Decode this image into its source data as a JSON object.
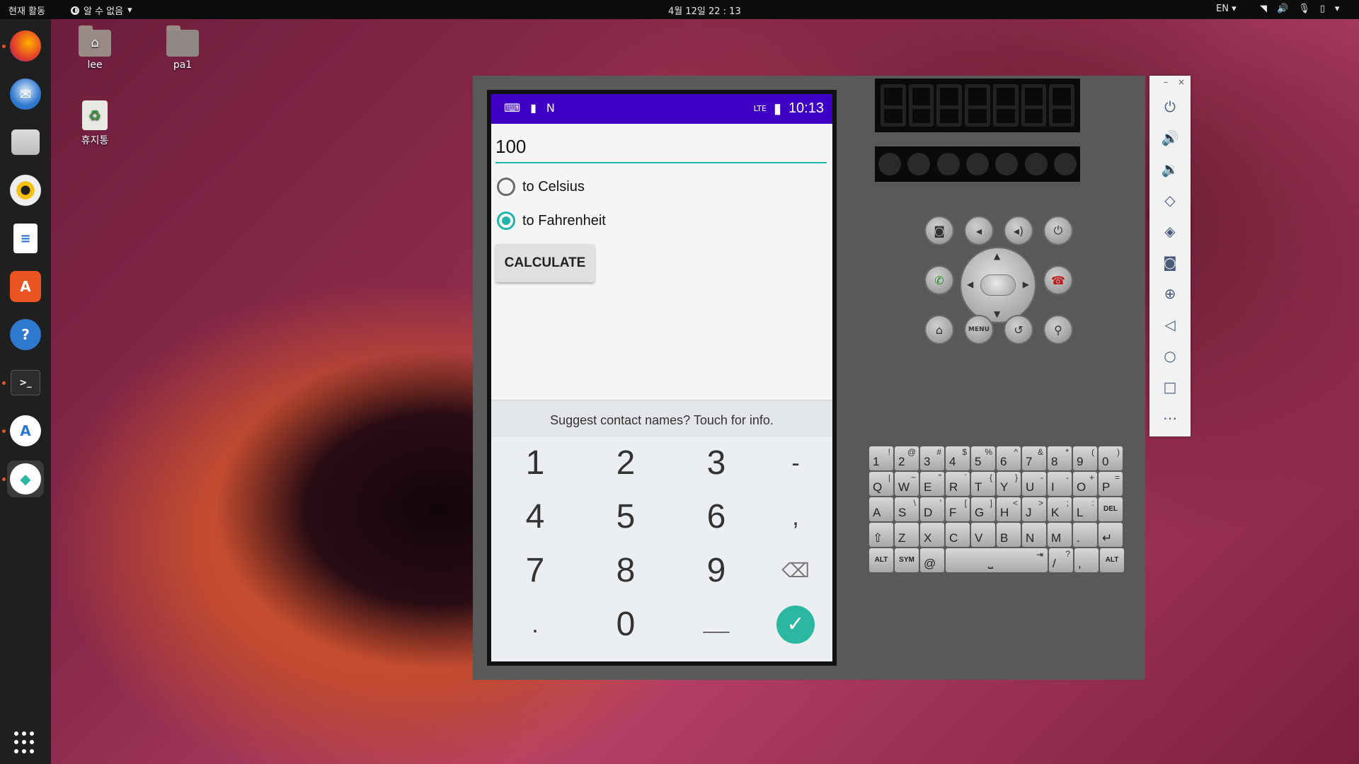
{
  "topbar": {
    "activities": "현재 활동",
    "notifications": "알 수 없음",
    "clock": "4월 12일  22 : 13",
    "lang": "EN",
    "tray_icons": [
      "wifi-icon",
      "volume-icon",
      "mic-icon",
      "battery-icon",
      "power-menu-icon"
    ]
  },
  "dock": {
    "items": [
      "firefox",
      "thunderbird",
      "files",
      "rhythmbox",
      "libreoffice-writer",
      "ubuntu-software",
      "help",
      "terminal",
      "android-studio",
      "android-emulator"
    ]
  },
  "desktop": {
    "icons": [
      {
        "label": "lee"
      },
      {
        "label": "pa1"
      },
      {
        "label": "휴지통"
      }
    ]
  },
  "phone": {
    "status_time": "10:13",
    "status_network": "LTE",
    "input_value": "100",
    "radio_celsius": "to Celsius",
    "radio_fahrenheit": "to Fahrenheit",
    "selected": "to Fahrenheit",
    "calculate": "CALCULATE",
    "suggest": "Suggest contact names? Touch for info.",
    "numpad": {
      "r1": [
        "1",
        "2",
        "3",
        "-"
      ],
      "r2": [
        "4",
        "5",
        "6",
        ","
      ],
      "r3": [
        "7",
        "8",
        "9"
      ],
      "r4": [
        ".",
        "0",
        "___"
      ]
    }
  },
  "emulator_hw": {
    "menu": "MENU",
    "qwerty": {
      "r1": [
        [
          "1",
          "!"
        ],
        [
          "2",
          "@"
        ],
        [
          "3",
          "#"
        ],
        [
          "4",
          "$"
        ],
        [
          "5",
          "%"
        ],
        [
          "6",
          "^"
        ],
        [
          "7",
          "&"
        ],
        [
          "8",
          "*"
        ],
        [
          "9",
          "("
        ],
        [
          "0",
          ")"
        ]
      ],
      "r2": [
        [
          "Q",
          "|"
        ],
        [
          "W",
          "~"
        ],
        [
          "E",
          "\""
        ],
        [
          "R",
          "`"
        ],
        [
          "T",
          "{"
        ],
        [
          "Y",
          "}"
        ],
        [
          "U",
          "-"
        ],
        [
          "I",
          "-"
        ],
        [
          "O",
          "+"
        ],
        [
          "P",
          "="
        ]
      ],
      "r3": [
        [
          "A",
          ""
        ],
        [
          "S",
          "\\"
        ],
        [
          "D",
          "'"
        ],
        [
          "F",
          "["
        ],
        [
          "G",
          "]"
        ],
        [
          "H",
          "<"
        ],
        [
          "J",
          ">"
        ],
        [
          "K",
          ";"
        ],
        [
          "L",
          ":"
        ]
      ],
      "r4": [
        [
          "Z",
          ""
        ],
        [
          "X",
          ""
        ],
        [
          "C",
          ""
        ],
        [
          "V",
          ""
        ],
        [
          "B",
          ""
        ],
        [
          "N",
          ""
        ],
        [
          "M",
          ""
        ],
        [
          ".",
          ""
        ]
      ],
      "alt": "ALT",
      "sym": "SYM",
      "at": "@",
      "del": "DEL",
      "slash": "/",
      "question": "?",
      "comma": ","
    }
  },
  "toolbar": {
    "items": [
      "power-icon",
      "volume-up-icon",
      "volume-down-icon",
      "rotate-left-icon",
      "rotate-right-icon",
      "screenshot-icon",
      "zoom-icon",
      "back-icon",
      "home-icon",
      "overview-icon",
      "more-icon"
    ]
  }
}
